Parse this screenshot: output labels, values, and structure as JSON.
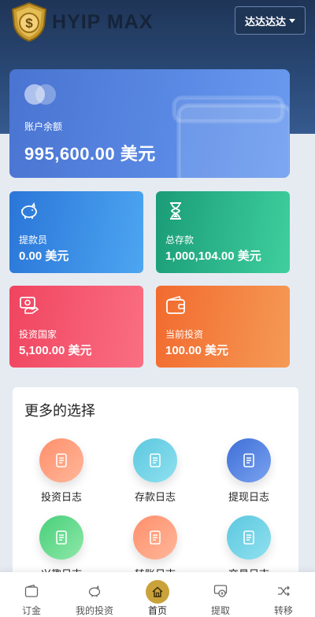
{
  "header": {
    "logo_text": "HYIP MAX",
    "language_button": "达达达达"
  },
  "balance": {
    "label": "账户余额",
    "value": "995,600.00 美元"
  },
  "stats": [
    {
      "label": "提款员",
      "value": "0.00 美元",
      "icon": "piggy-bank-icon"
    },
    {
      "label": "总存款",
      "value": "1,000,104.00 美元",
      "icon": "hourglass-icon"
    },
    {
      "label": "投资国家",
      "value": "5,100.00 美元",
      "icon": "money-icon"
    },
    {
      "label": "当前投资",
      "value": "100.00 美元",
      "icon": "wallet-icon"
    }
  ],
  "options": {
    "title": "更多的选择",
    "items": [
      {
        "label": "投资日志",
        "color": "#ff9a7a"
      },
      {
        "label": "存款日志",
        "color": "#6fd0e6"
      },
      {
        "label": "提现日志",
        "color": "#4f7fe0"
      },
      {
        "label": "兴趣日志",
        "color": "#5fd88b"
      },
      {
        "label": "转账日志",
        "color": "#ff9a7a"
      },
      {
        "label": "交易日志",
        "color": "#6fd0e6"
      }
    ]
  },
  "bottom_nav": [
    {
      "label": "订金",
      "icon": "wallet-icon"
    },
    {
      "label": "我的投资",
      "icon": "piggy-bank-icon"
    },
    {
      "label": "首页",
      "icon": "home-icon",
      "active": true
    },
    {
      "label": "提取",
      "icon": "withdraw-icon"
    },
    {
      "label": "转移",
      "icon": "shuffle-icon"
    }
  ],
  "colors": {
    "accent_gold": "#caa23a",
    "header_dark": "#1f3557",
    "balance_blue": "#4a74d1"
  }
}
